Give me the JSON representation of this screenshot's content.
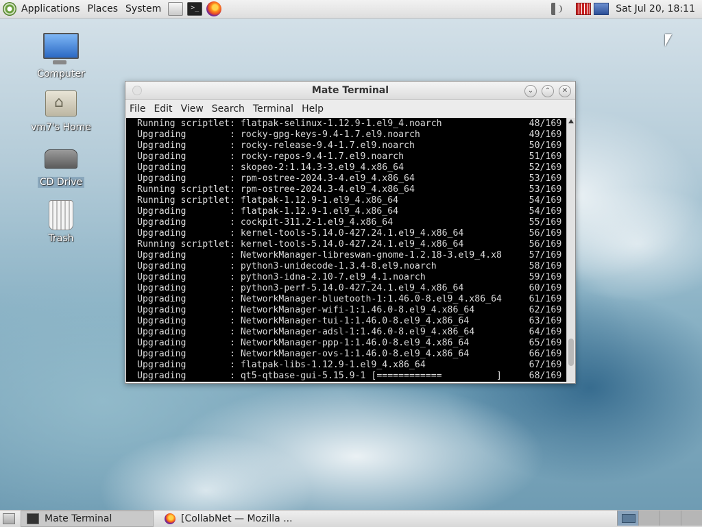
{
  "top_panel": {
    "menus": [
      "Applications",
      "Places",
      "System"
    ],
    "clock": "Sat Jul 20, 18:11"
  },
  "desktop_icons": [
    {
      "label": "Computer",
      "icon": "computer-icon"
    },
    {
      "label": "vm7's Home",
      "icon": "home-folder-icon"
    },
    {
      "label": "CD Drive",
      "icon": "cd-drive-icon"
    },
    {
      "label": "Trash",
      "icon": "trash-icon"
    }
  ],
  "window": {
    "title": "Mate Terminal",
    "menu": [
      "File",
      "Edit",
      "View",
      "Search",
      "Terminal",
      "Help"
    ]
  },
  "terminal": {
    "lines": [
      "Running scriptlet: flatpak-selinux-1.12.9-1.el9_4.noarch                48/169",
      "Upgrading        : rocky-gpg-keys-9.4-1.7.el9.noarch                    49/169",
      "Upgrading        : rocky-release-9.4-1.7.el9.noarch                     50/169",
      "Upgrading        : rocky-repos-9.4-1.7.el9.noarch                       51/169",
      "Upgrading        : skopeo-2:1.14.3-3.el9_4.x86_64                       52/169",
      "Upgrading        : rpm-ostree-2024.3-4.el9_4.x86_64                     53/169",
      "Running scriptlet: rpm-ostree-2024.3-4.el9_4.x86_64                     53/169",
      "Running scriptlet: flatpak-1.12.9-1.el9_4.x86_64                        54/169",
      "Upgrading        : flatpak-1.12.9-1.el9_4.x86_64                        54/169",
      "Upgrading        : cockpit-311.2-1.el9_4.x86_64                         55/169",
      "Upgrading        : kernel-tools-5.14.0-427.24.1.el9_4.x86_64            56/169",
      "Running scriptlet: kernel-tools-5.14.0-427.24.1.el9_4.x86_64            56/169",
      "Upgrading        : NetworkManager-libreswan-gnome-1.2.18-3.el9_4.x8     57/169",
      "Upgrading        : python3-unidecode-1.3.4-8.el9.noarch                 58/169",
      "Upgrading        : python3-idna-2.10-7.el9_4.1.noarch                   59/169",
      "Upgrading        : python3-perf-5.14.0-427.24.1.el9_4.x86_64            60/169",
      "Upgrading        : NetworkManager-bluetooth-1:1.46.0-8.el9_4.x86_64     61/169",
      "Upgrading        : NetworkManager-wifi-1:1.46.0-8.el9_4.x86_64          62/169",
      "Upgrading        : NetworkManager-tui-1:1.46.0-8.el9_4.x86_64           63/169",
      "Upgrading        : NetworkManager-adsl-1:1.46.0-8.el9_4.x86_64          64/169",
      "Upgrading        : NetworkManager-ppp-1:1.46.0-8.el9_4.x86_64           65/169",
      "Upgrading        : NetworkManager-ovs-1:1.46.0-8.el9_4.x86_64           66/169",
      "Upgrading        : flatpak-libs-1.12.9-1.el9_4.x86_64                   67/169",
      "Upgrading        : qt5-qtbase-gui-5.15.9-1 [============          ]     68/169"
    ]
  },
  "taskbar": {
    "tasks": [
      {
        "label": "Mate Terminal",
        "icon": "terminal-icon"
      },
      {
        "label": "[CollabNet — Mozilla ...",
        "icon": "firefox-icon"
      }
    ]
  }
}
